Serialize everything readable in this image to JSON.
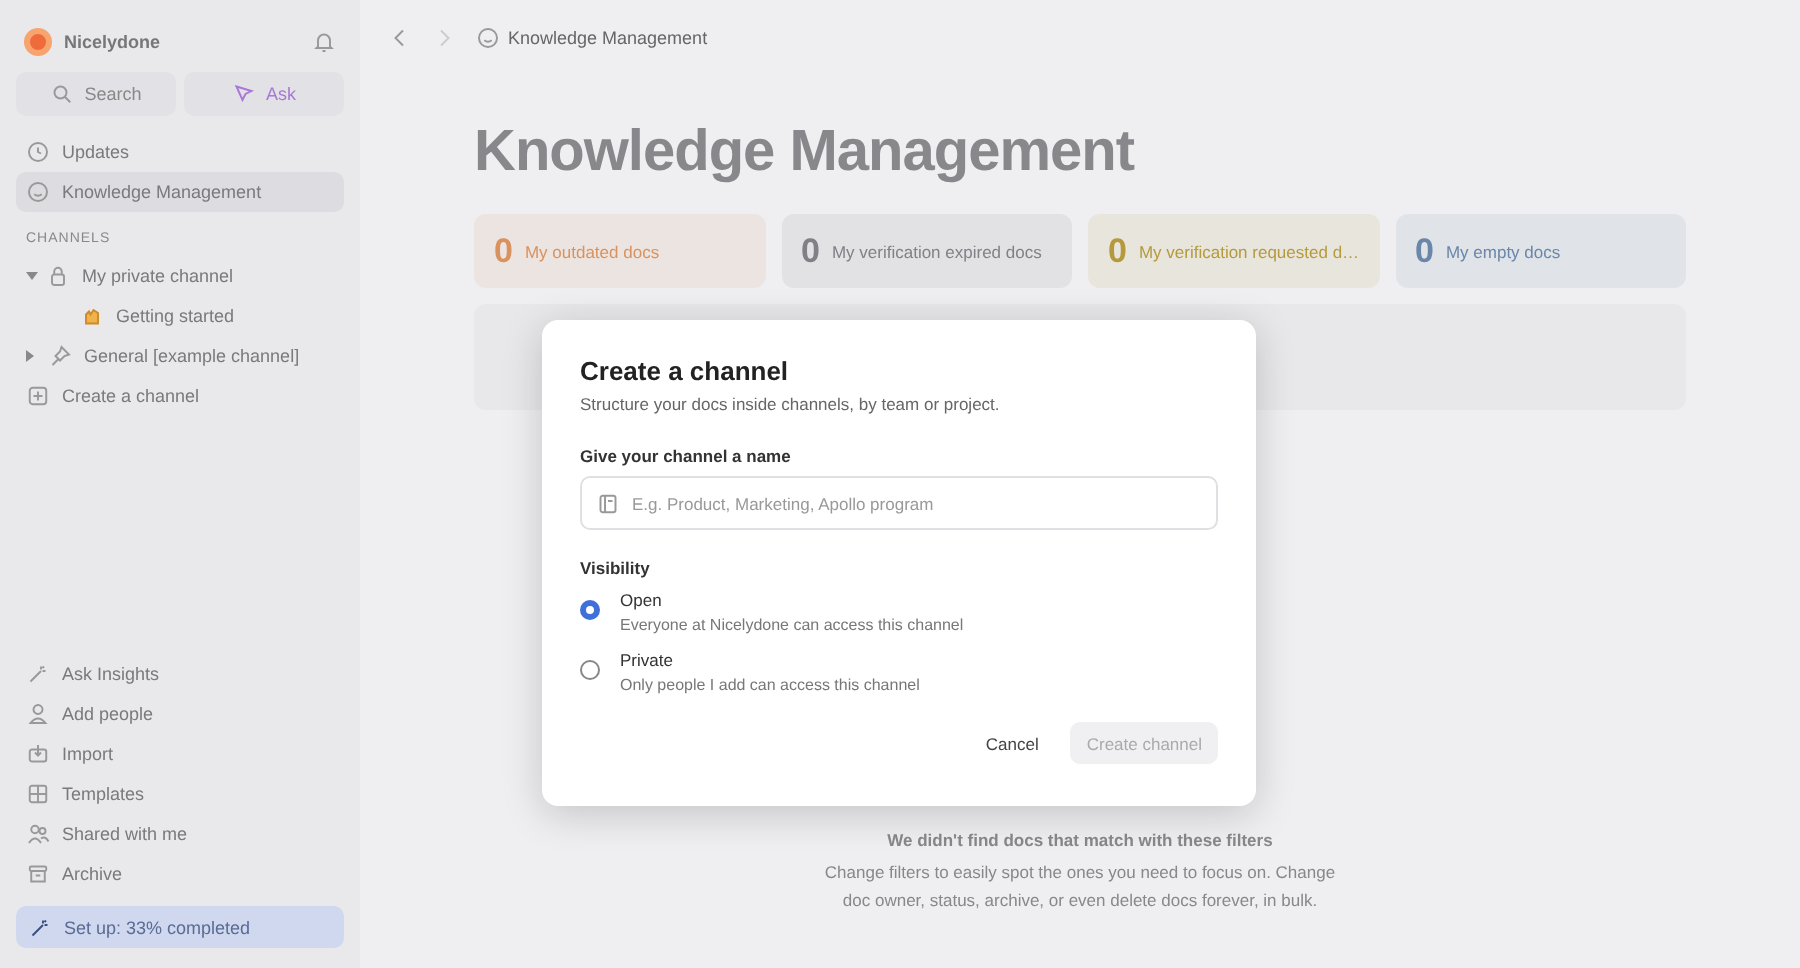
{
  "sidebar": {
    "workspace": "Nicelydone",
    "search_label": "Search",
    "ask_label": "Ask",
    "nav": [
      {
        "label": "Updates",
        "selected": false
      },
      {
        "label": "Knowledge Management",
        "selected": true
      }
    ],
    "channels_heading": "CHANNELS",
    "channels": [
      {
        "label": "My private channel",
        "expanded": true,
        "children": [
          {
            "label": "Getting started"
          }
        ]
      },
      {
        "label": "General [example channel]",
        "expanded": false
      }
    ],
    "create_channel": "Create a channel",
    "bottom": [
      {
        "label": "Ask Insights"
      },
      {
        "label": "Add people"
      },
      {
        "label": "Import"
      },
      {
        "label": "Templates"
      },
      {
        "label": "Shared with me"
      },
      {
        "label": "Archive"
      }
    ],
    "setup": {
      "label": "Set up: 33% completed"
    }
  },
  "breadcrumb": "Knowledge Management",
  "page_title": "Knowledge Management",
  "stats": [
    {
      "count": "0",
      "label": "My outdated docs",
      "color": "#d9925e"
    },
    {
      "count": "0",
      "label": "My verification expired docs",
      "color": "#808086"
    },
    {
      "count": "0",
      "label": "My verification requested d…",
      "color": "#b59a3c"
    },
    {
      "count": "0",
      "label": "My empty docs",
      "color": "#6a86a8"
    }
  ],
  "empty_state": {
    "title": "We didn't find docs that match with these filters",
    "text": "Change filters to easily spot the ones you need to focus on. Change doc owner, status, archive, or even delete docs forever, in bulk."
  },
  "dialog": {
    "title": "Create a channel",
    "subtitle": "Structure your docs inside channels, by team or project.",
    "name_label": "Give your channel a name",
    "name_placeholder": "E.g. Product, Marketing, Apollo program",
    "visibility_label": "Visibility",
    "options": [
      {
        "label": "Open",
        "description": "Everyone at Nicelydone can access this channel",
        "selected": true
      },
      {
        "label": "Private",
        "description": "Only people I add can access this channel",
        "selected": false
      }
    ],
    "cancel": "Cancel",
    "submit": {
      "label": "Create channel",
      "disabled": true
    }
  }
}
